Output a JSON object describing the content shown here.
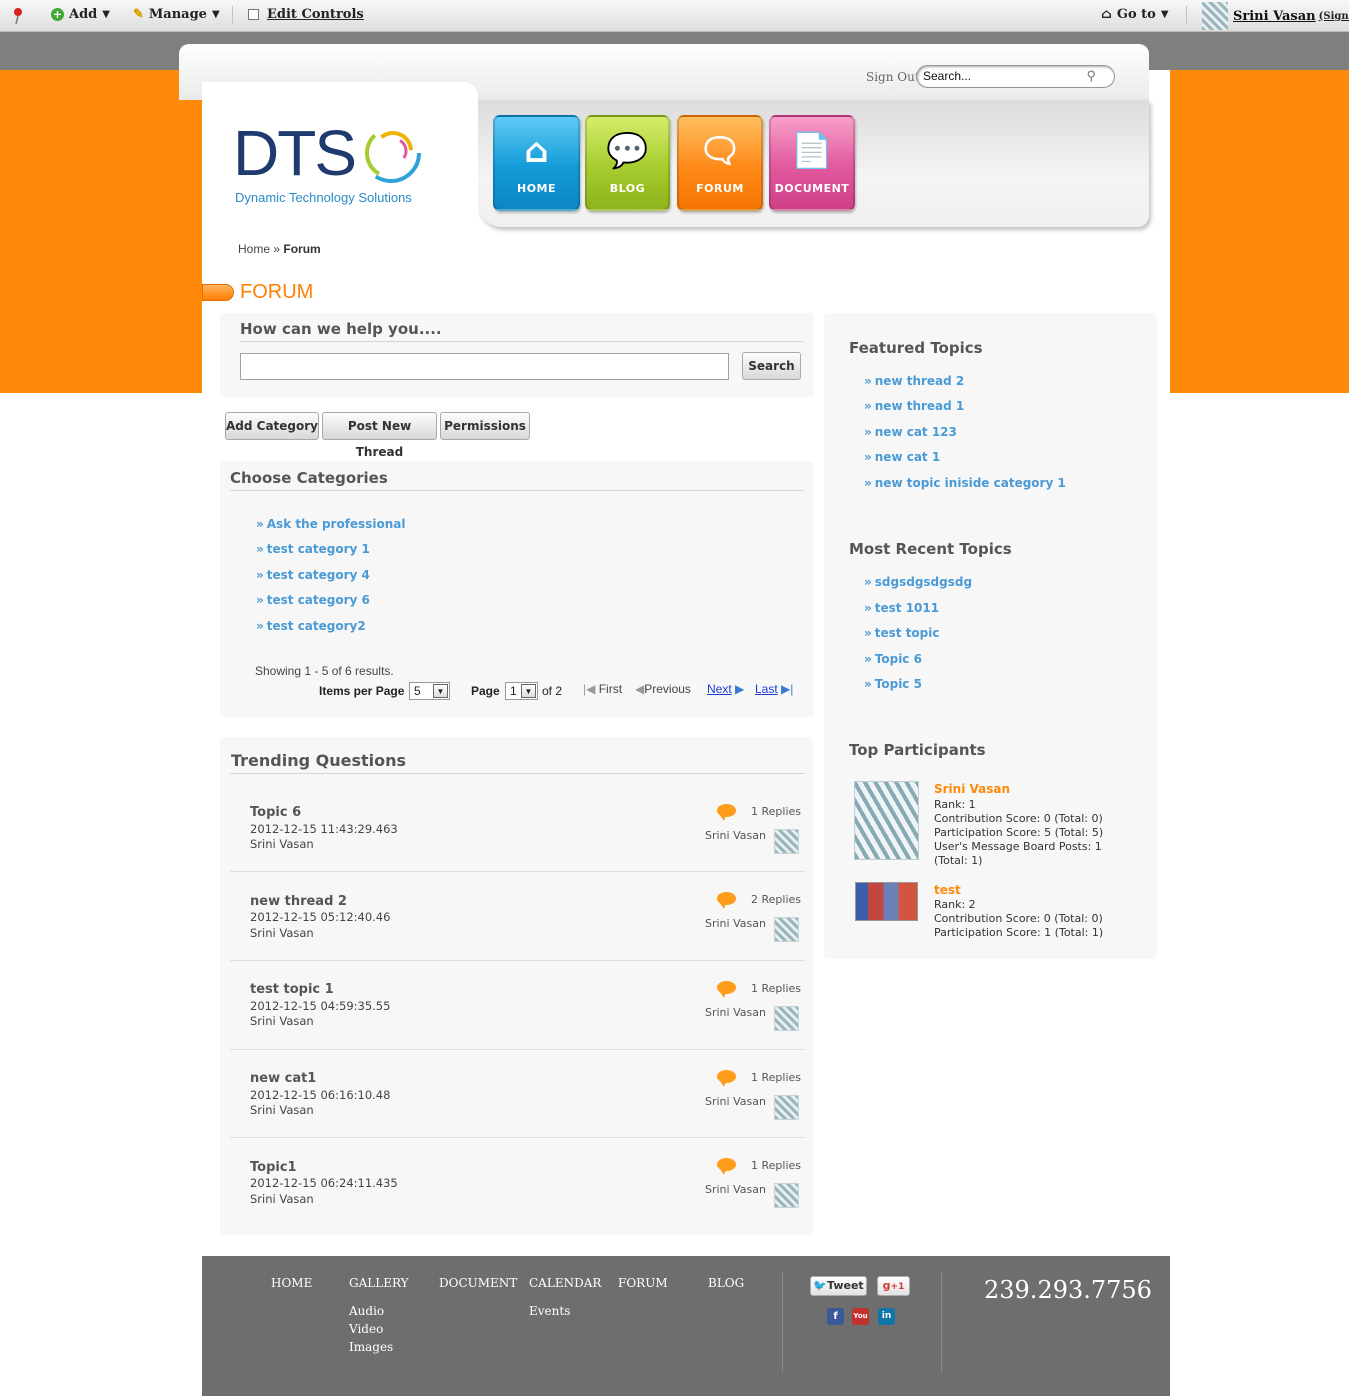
{
  "toolbar": {
    "add_label": "Add",
    "manage_label": "Manage",
    "edit_controls_label": "Edit Controls",
    "goto_label": "Go to",
    "user_name": "Srini Vasan",
    "sign_out": "(Sign Out)"
  },
  "header": {
    "sign_out": "Sign Out",
    "search_value": "Search...",
    "logo_text": "DTS",
    "logo_tagline": "Dynamic Technology Solutions",
    "nav": [
      {
        "label": "HOME",
        "color": "#1aa0dc"
      },
      {
        "label": "BLOG",
        "color": "#a6cc2f"
      },
      {
        "label": "FORUM",
        "color": "#ff8a1a"
      },
      {
        "label": "DOCUMENT",
        "color": "#e0589d"
      }
    ]
  },
  "breadcrumb": {
    "home": "Home",
    "sep": "»",
    "current": "Forum"
  },
  "page_title": "FORUM",
  "help": {
    "heading": "How can we help you....",
    "search_button": "Search"
  },
  "actions": {
    "add_category": "Add Category",
    "post_new_thread": "Post New Thread",
    "permissions": "Permissions"
  },
  "categories": {
    "heading": "Choose Categories",
    "items": [
      "Ask the professional",
      "test category 1",
      "test category 4",
      "test category 6",
      "test category2"
    ],
    "showing": "Showing 1 - 5 of 6 results.",
    "items_per_page_label": "Items per Page",
    "items_per_page": "5",
    "page_label": "Page",
    "page": "1",
    "of_pages": "of 2",
    "first": "First",
    "previous": "Previous",
    "next": "Next",
    "last": "Last"
  },
  "trending": {
    "heading": "Trending Questions",
    "items": [
      {
        "title": "Topic 6",
        "date": "2012-12-15 11:43:29.463",
        "author": "Srini Vasan",
        "replies": "1 Replies",
        "user": "Srini Vasan"
      },
      {
        "title": "new thread 2",
        "date": "2012-12-15 05:12:40.46",
        "author": "Srini Vasan",
        "replies": "2 Replies",
        "user": "Srini Vasan"
      },
      {
        "title": "test topic 1",
        "date": "2012-12-15 04:59:35.55",
        "author": "Srini Vasan",
        "replies": "1 Replies",
        "user": "Srini Vasan"
      },
      {
        "title": "new cat1",
        "date": "2012-12-15 06:16:10.48",
        "author": "Srini Vasan",
        "replies": "1 Replies",
        "user": "Srini Vasan"
      },
      {
        "title": "Topic1",
        "date": "2012-12-15 06:24:11.435",
        "author": "Srini Vasan",
        "replies": "1 Replies",
        "user": "Srini Vasan"
      }
    ]
  },
  "sidebar": {
    "featured_heading": "Featured Topics",
    "featured": [
      "new thread 2",
      "new thread 1",
      "new cat 123",
      "new cat 1",
      "new topic iniside category 1"
    ],
    "recent_heading": "Most Recent Topics",
    "recent": [
      "sdgsdgsdgsdg",
      "test 1011",
      "test topic",
      "Topic 6",
      "Topic 5"
    ],
    "participants_heading": "Top Participants",
    "participants": [
      {
        "name": "Srini Vasan",
        "lines": [
          "Rank: 1",
          "Contribution Score: 0 (Total: 0)",
          "Participation Score: 5 (Total: 5)",
          "User's Message Board Posts: 1",
          "(Total: 1)"
        ]
      },
      {
        "name": "test",
        "lines": [
          "Rank: 2",
          "Contribution Score: 0 (Total: 0)",
          "Participation Score: 1 (Total: 1)"
        ]
      }
    ]
  },
  "footer": {
    "nav": [
      "HOME",
      "GALLERY",
      "DOCUMENT",
      "CALENDAR",
      "FORUM",
      "BLOG"
    ],
    "gallery_sub": [
      "Audio",
      "Video",
      "Images"
    ],
    "calendar_sub": [
      "Events"
    ],
    "tweet": "Tweet",
    "gplus": "+1",
    "phone": "239.293.7756"
  }
}
